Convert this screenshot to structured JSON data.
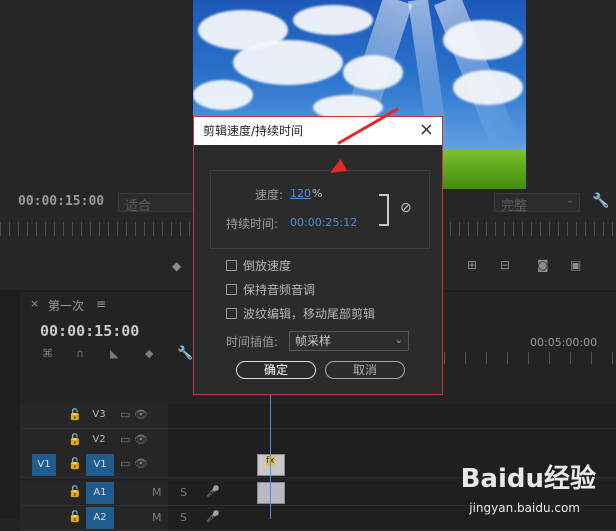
{
  "monitor": {
    "timecode": "00:00:15:00",
    "fit_select": "适合",
    "quality_select": "完整",
    "wrench_icon": "wrench-icon"
  },
  "timeline": {
    "tab_close": "×",
    "tab_name": "第一次",
    "menu_icon": "≡",
    "timecode": "00:00:15:00",
    "ruler_time": "00:05:00:00",
    "tracks": [
      {
        "lock": "🔓",
        "label": "V3",
        "icons": "▭  👁"
      },
      {
        "lock": "🔓",
        "label": "V2",
        "icons": "▭  👁"
      },
      {
        "src": "V1",
        "lock": "🔓",
        "label": "V1",
        "icons": "▭  👁"
      },
      {
        "lock": "🔓",
        "label": "A1",
        "m": "M",
        "s": "S"
      },
      {
        "lock": "🔓",
        "label": "A2",
        "m": "M",
        "s": "S"
      }
    ],
    "clip_fx": "fx"
  },
  "dialog": {
    "title": "剪辑速度/持续时间",
    "close": "×",
    "speed_label": "速度:",
    "speed_value": "120",
    "speed_unit": "%",
    "duration_label": "持续时间:",
    "duration_value": "00:00:25:12",
    "options": [
      "倒放速度",
      "保持音频音调",
      "波纹编辑，移动尾部剪辑"
    ],
    "interp_label": "时间插值:",
    "interp_value": "帧采样",
    "ok_label": "确定",
    "cancel_label": "取消"
  },
  "watermark": {
    "brand": "Baidu经验",
    "url": "jingyan.baidu.com"
  },
  "colors": {
    "accent": "#4a8fd8",
    "dialog_border": "#c43a3a",
    "arrow": "#e02a2a",
    "track_blue": "#1f5c8f"
  }
}
